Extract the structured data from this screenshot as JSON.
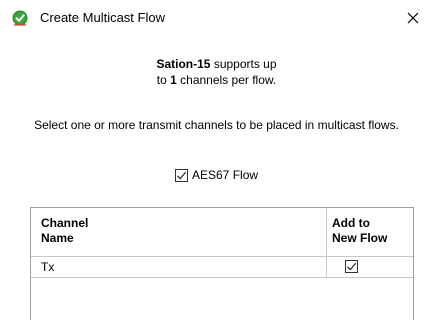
{
  "window": {
    "title": "Create Multicast Flow",
    "close_glyph": "✕",
    "icon": "green-checkmark-icon"
  },
  "info": {
    "device_name": "Sation-15",
    "line1_rest": " supports up",
    "line2_prefix": "to ",
    "channel_count": "1",
    "line2_suffix": " channels per flow."
  },
  "instruction": "Select one or more transmit channels to be placed in multicast flows.",
  "aes67": {
    "label": "AES67 Flow",
    "checked": true
  },
  "table": {
    "columns": [
      "Channel Name",
      "Add to New Flow"
    ],
    "col1_line1": "Channel",
    "col1_line2": "Name",
    "col2_line1": "Add to",
    "col2_line2": "New Flow",
    "rows": [
      {
        "name": "Tx",
        "checked": true
      }
    ]
  },
  "colors": {
    "accent_green": "#3aa53a",
    "border": "#a0a0a0"
  }
}
